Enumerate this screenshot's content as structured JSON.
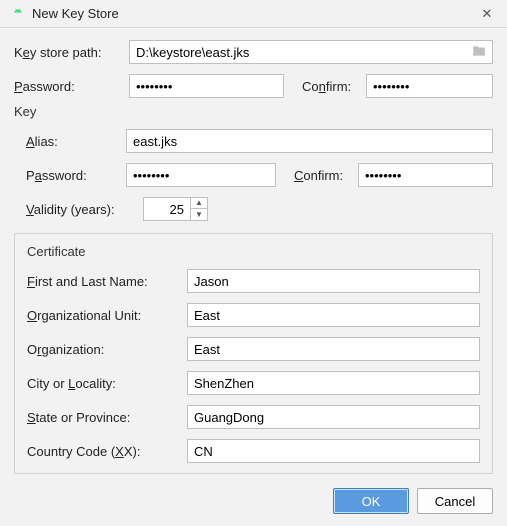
{
  "window": {
    "title": "New Key Store"
  },
  "path": {
    "label_pre": "K",
    "label_u": "e",
    "label_post": "y store path:",
    "value": "D:\\keystore\\east.jks"
  },
  "top_pw": {
    "label_u": "P",
    "label_post": "assword:",
    "value": "••••••••",
    "confirm_pre": "Co",
    "confirm_u": "n",
    "confirm_post": "firm:",
    "confirm_value": "••••••••"
  },
  "key_section": {
    "title": "Key"
  },
  "alias": {
    "label_u": "A",
    "label_post": "lias:",
    "value": "east.jks"
  },
  "key_pw": {
    "label_pre": "P",
    "label_u": "a",
    "label_post": "ssword:",
    "value": "••••••••",
    "confirm_u": "C",
    "confirm_post": "onfirm:",
    "confirm_value": "••••••••"
  },
  "validity": {
    "label_u": "V",
    "label_post": "alidity (years):",
    "value": "25"
  },
  "cert": {
    "title": "Certificate",
    "name": {
      "label_u": "F",
      "label_post": "irst and Last Name:",
      "value": "Jason"
    },
    "ou": {
      "label_u": "O",
      "label_post": "rganizational Unit:",
      "value": "East"
    },
    "org": {
      "label_pre": "O",
      "label_u": "r",
      "label_post": "ganization:",
      "value": "East"
    },
    "city": {
      "label_pre": "City or ",
      "label_u": "L",
      "label_post": "ocality:",
      "value": "ShenZhen"
    },
    "state": {
      "label_u": "S",
      "label_post": "tate or Province:",
      "value": "GuangDong"
    },
    "cc": {
      "label_pre": "Country Code (",
      "label_u": "X",
      "label_post": "X):",
      "value": "CN"
    }
  },
  "buttons": {
    "ok": "OK",
    "cancel": "Cancel"
  }
}
